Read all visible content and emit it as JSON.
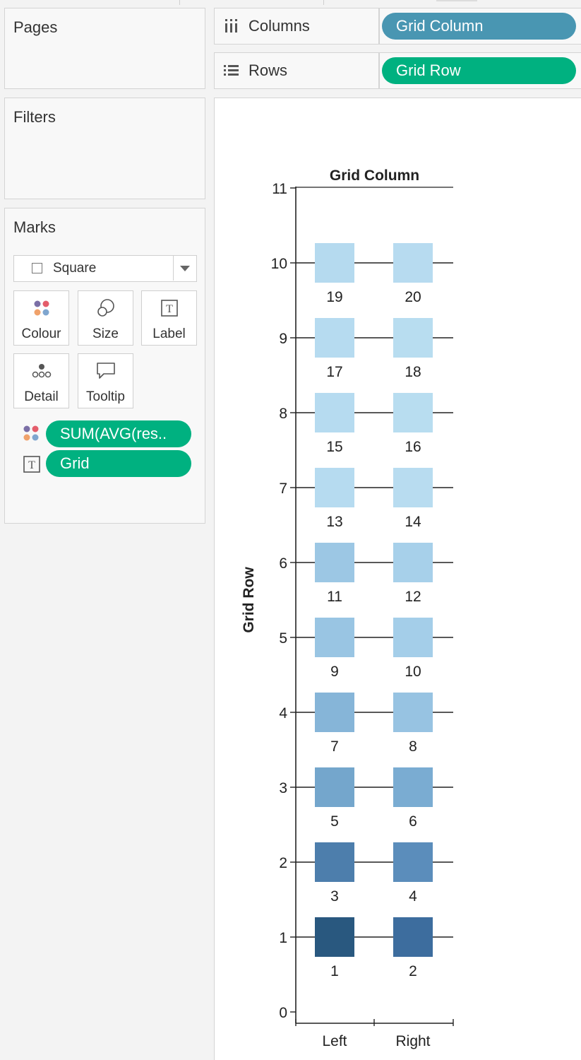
{
  "cards": {
    "pages_title": "Pages",
    "filters_title": "Filters",
    "marks_title": "Marks"
  },
  "marks": {
    "mark_type": "Square",
    "buttons": {
      "colour": "Colour",
      "size": "Size",
      "label": "Label",
      "detail": "Detail",
      "tooltip": "Tooltip"
    },
    "fields": [
      {
        "encoding": "colour",
        "field": "SUM(AVG(res.."
      },
      {
        "encoding": "label",
        "field": "Grid"
      }
    ]
  },
  "shelves": {
    "columns_label": "Columns",
    "columns_pill": "Grid Column",
    "rows_label": "Rows",
    "rows_pill": "Grid Row"
  },
  "colors": {
    "dimension_pill": "#4996b2",
    "measure_pill": "#00b180"
  },
  "chart_data": {
    "type": "heatmap",
    "title": "Grid Column",
    "xlabel": "",
    "ylabel": "Grid Row",
    "categories": [
      "Left",
      "Right"
    ],
    "yticks": [
      0,
      1,
      2,
      3,
      4,
      5,
      6,
      7,
      8,
      9,
      10,
      11
    ],
    "ylim": [
      0,
      11
    ],
    "grid": "horizontal reference lines at each mark row",
    "marks": [
      {
        "column": "Left",
        "row": 1,
        "label": "1",
        "color": "#29587f"
      },
      {
        "column": "Right",
        "row": 1,
        "label": "2",
        "color": "#3d6d9e"
      },
      {
        "column": "Left",
        "row": 2,
        "label": "3",
        "color": "#4d7eac"
      },
      {
        "column": "Right",
        "row": 2,
        "label": "4",
        "color": "#5b8dbb"
      },
      {
        "column": "Left",
        "row": 3,
        "label": "5",
        "color": "#74a6cc"
      },
      {
        "column": "Right",
        "row": 3,
        "label": "6",
        "color": "#7aacd2"
      },
      {
        "column": "Left",
        "row": 4,
        "label": "7",
        "color": "#86b5d8"
      },
      {
        "column": "Right",
        "row": 4,
        "label": "8",
        "color": "#97c3e2"
      },
      {
        "column": "Left",
        "row": 5,
        "label": "9",
        "color": "#99c5e3"
      },
      {
        "column": "Right",
        "row": 5,
        "label": "10",
        "color": "#a4cee9"
      },
      {
        "column": "Left",
        "row": 6,
        "label": "11",
        "color": "#9cc7e4"
      },
      {
        "column": "Right",
        "row": 6,
        "label": "12",
        "color": "#a7d0ea"
      },
      {
        "column": "Left",
        "row": 7,
        "label": "13",
        "color": "#b6dbf0"
      },
      {
        "column": "Right",
        "row": 7,
        "label": "14",
        "color": "#b8dcf0"
      },
      {
        "column": "Left",
        "row": 8,
        "label": "15",
        "color": "#b6dbf0"
      },
      {
        "column": "Right",
        "row": 8,
        "label": "16",
        "color": "#b8ddf0"
      },
      {
        "column": "Left",
        "row": 9,
        "label": "17",
        "color": "#b6dbf0"
      },
      {
        "column": "Right",
        "row": 9,
        "label": "18",
        "color": "#b8ddf0"
      },
      {
        "column": "Left",
        "row": 10,
        "label": "19",
        "color": "#b5daef"
      },
      {
        "column": "Right",
        "row": 10,
        "label": "20",
        "color": "#b7dbf0"
      }
    ]
  }
}
